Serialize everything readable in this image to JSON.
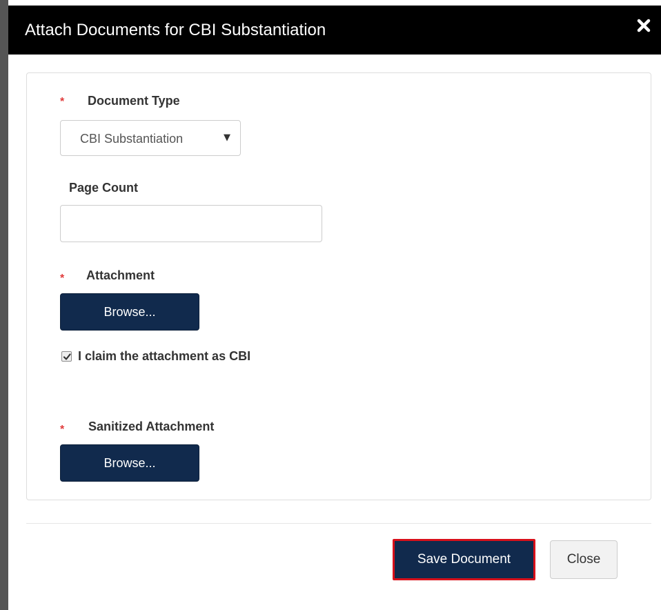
{
  "modal": {
    "title": "Attach Documents for CBI Substantiation",
    "close_icon": "close-x-icon"
  },
  "form": {
    "required_marker": "*",
    "document_type": {
      "label": "Document Type",
      "selected": "CBI Substantiation"
    },
    "page_count": {
      "label": "Page Count",
      "value": "",
      "placeholder": ""
    },
    "attachment": {
      "label": "Attachment",
      "browse_label": "Browse..."
    },
    "cbi_claim": {
      "label": "I claim the attachment as CBI",
      "checked": true
    },
    "sanitized_attachment": {
      "label": "Sanitized Attachment",
      "browse_label": "Browse..."
    }
  },
  "footer": {
    "save_label": "Save Document",
    "close_label": "Close"
  },
  "colors": {
    "header_bg": "#000000",
    "primary_button": "#112a4d",
    "highlight_border": "#d8101a",
    "required_marker": "#e03a3a"
  }
}
